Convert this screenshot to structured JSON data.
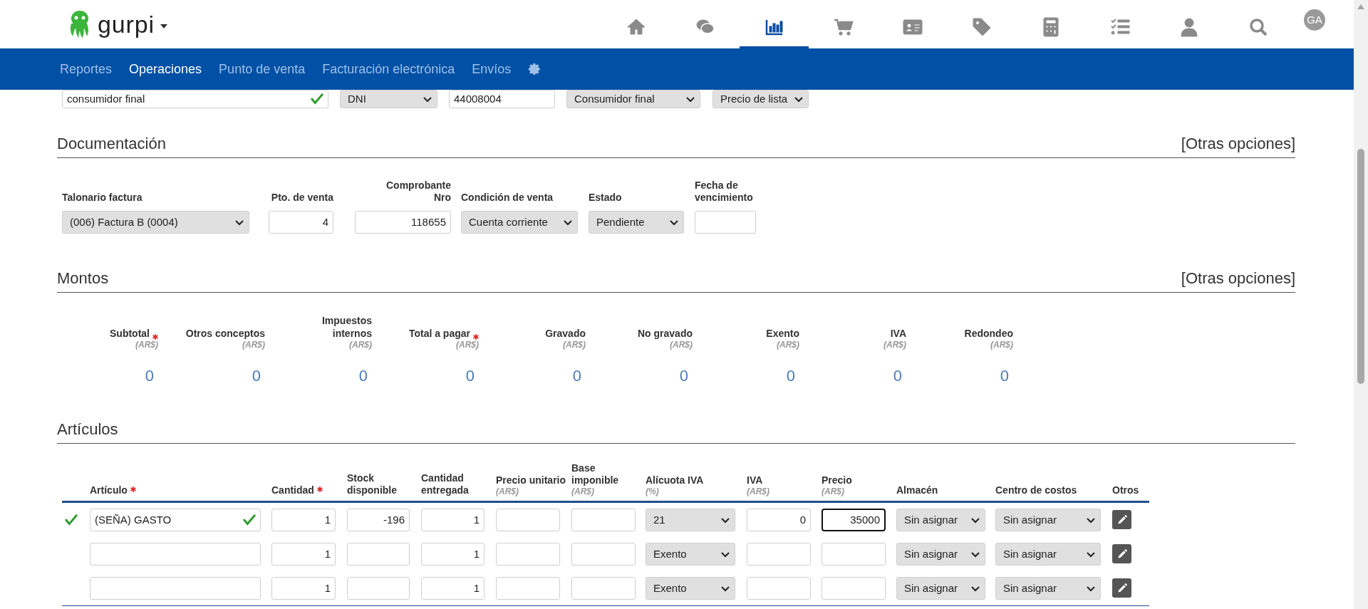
{
  "app": {
    "name": "gurpi"
  },
  "toolbar": [
    {
      "kind": "home",
      "selected": false
    },
    {
      "kind": "chat",
      "selected": false
    },
    {
      "kind": "chart",
      "selected": true
    },
    {
      "kind": "cart",
      "selected": false
    },
    {
      "kind": "card",
      "selected": false
    },
    {
      "kind": "tag",
      "selected": false
    },
    {
      "kind": "calculator",
      "selected": false
    },
    {
      "kind": "checklist",
      "selected": false
    },
    {
      "kind": "user",
      "selected": false
    },
    {
      "kind": "search",
      "selected": false
    }
  ],
  "avatar": "GA",
  "nav": [
    {
      "label": "Reportes",
      "selected": false
    },
    {
      "label": "Operaciones",
      "selected": true
    },
    {
      "label": "Punto de venta",
      "selected": false
    },
    {
      "label": "Facturación electrónica",
      "selected": false
    },
    {
      "label": "Envíos",
      "selected": false
    }
  ],
  "customer_row": [
    {
      "kind": "input",
      "value": "consumidor final",
      "valid": true
    },
    {
      "kind": "select",
      "value": "DNI"
    },
    {
      "kind": "input",
      "value": "44008004",
      "valid": false
    },
    {
      "kind": "select",
      "value": "Consumidor final"
    },
    {
      "kind": "select",
      "value": "Precio de lista"
    }
  ],
  "documentacion": {
    "title": "Documentación",
    "link": "[Otras opciones]",
    "fields": [
      {
        "label": "Talonario factura",
        "kind": "select",
        "value": "(006) Factura B (0004)"
      },
      {
        "label": "Pto. de venta",
        "kind": "number",
        "value": "4"
      },
      {
        "label": "Comprobante Nro",
        "kind": "number",
        "value": "118655"
      },
      {
        "label": "Condición de venta",
        "kind": "select",
        "value": "Cuenta corriente"
      },
      {
        "label": "Estado",
        "kind": "select",
        "value": "Pendiente"
      },
      {
        "label": "Fecha de vencimiento",
        "kind": "input"
      }
    ]
  },
  "montos": {
    "title": "Montos",
    "link": "[Otras opciones]",
    "columns": [
      {
        "label": "Subtotal",
        "required": true,
        "unit": "(AR$)",
        "value": "0"
      },
      {
        "label": "Otros conceptos",
        "required": false,
        "unit": "(AR$)",
        "value": "0"
      },
      {
        "label": "Impuestos internos",
        "required": false,
        "unit": "(AR$)",
        "value": "0"
      },
      {
        "label": "Total a pagar",
        "required": true,
        "unit": "(AR$)",
        "value": "0"
      },
      {
        "label": "Gravado",
        "required": false,
        "unit": "(AR$)",
        "value": "0"
      },
      {
        "label": "No gravado",
        "required": false,
        "unit": "(AR$)",
        "value": "0"
      },
      {
        "label": "Exento",
        "required": false,
        "unit": "(AR$)",
        "value": "0"
      },
      {
        "label": "IVA",
        "required": false,
        "unit": "(AR$)",
        "value": "0"
      },
      {
        "label": "Redondeo",
        "required": false,
        "unit": "(AR$)",
        "value": "0"
      }
    ]
  },
  "articulos": {
    "title": "Artículos",
    "columns": [
      {
        "label": "Artículo",
        "required": true
      },
      {
        "label": "Cantidad",
        "required": true
      },
      {
        "label": "Stock disponible",
        "required": false
      },
      {
        "label": "Cantidad entregada",
        "required": false
      },
      {
        "label": "Precio unitario",
        "required": false,
        "unit": "(AR$)"
      },
      {
        "label": "Base imponible",
        "required": false,
        "unit": "(AR$)"
      },
      {
        "label": "Alícuota IVA",
        "required": false,
        "unit": "(%)"
      },
      {
        "label": "IVA",
        "required": false,
        "unit": "(AR$)"
      },
      {
        "label": "Precio",
        "required": false,
        "unit": "(AR$)"
      },
      {
        "label": "Almacén",
        "required": false
      },
      {
        "label": "Centro de costos",
        "required": false
      },
      {
        "label": "Otros",
        "required": false
      }
    ],
    "rows": [
      {
        "valid": true,
        "cells": [
          {
            "kind": "text",
            "value": "(SEÑA) GASTO",
            "focused": false
          },
          {
            "kind": "number",
            "value": "1",
            "focused": false
          },
          {
            "kind": "number",
            "value": "-196",
            "focused": false
          },
          {
            "kind": "number",
            "value": "1",
            "focused": false
          },
          {
            "kind": "number",
            "focused": false
          },
          {
            "kind": "number",
            "focused": false
          },
          {
            "kind": "select",
            "value": "21",
            "focused": false
          },
          {
            "kind": "number",
            "value": "0",
            "focused": false
          },
          {
            "kind": "number",
            "value": "35000",
            "focused": true
          },
          {
            "kind": "select",
            "value": "Sin asignar",
            "focused": false
          },
          {
            "kind": "select",
            "value": "Sin asignar",
            "focused": false
          },
          {
            "kind": "edit",
            "focused": false
          }
        ]
      },
      {
        "valid": false,
        "cells": [
          {
            "kind": "text",
            "focused": false
          },
          {
            "kind": "number",
            "value": "1",
            "focused": false
          },
          {
            "kind": "number",
            "focused": false
          },
          {
            "kind": "number",
            "value": "1",
            "focused": false
          },
          {
            "kind": "number",
            "focused": false
          },
          {
            "kind": "number",
            "focused": false
          },
          {
            "kind": "select",
            "value": "Exento",
            "focused": false
          },
          {
            "kind": "number",
            "focused": false
          },
          {
            "kind": "number",
            "focused": false
          },
          {
            "kind": "select",
            "value": "Sin asignar",
            "focused": false
          },
          {
            "kind": "select",
            "value": "Sin asignar",
            "focused": false
          },
          {
            "kind": "edit",
            "focused": false
          }
        ]
      },
      {
        "valid": false,
        "cells": [
          {
            "kind": "text",
            "focused": false
          },
          {
            "kind": "number",
            "value": "1",
            "focused": false
          },
          {
            "kind": "number",
            "focused": false
          },
          {
            "kind": "number",
            "value": "1",
            "focused": false
          },
          {
            "kind": "number",
            "focused": false
          },
          {
            "kind": "number",
            "focused": false
          },
          {
            "kind": "select",
            "value": "Exento",
            "focused": false
          },
          {
            "kind": "number",
            "focused": false
          },
          {
            "kind": "number",
            "focused": false
          },
          {
            "kind": "select",
            "value": "Sin asignar",
            "focused": false
          },
          {
            "kind": "select",
            "value": "Sin asignar",
            "focused": false
          },
          {
            "kind": "edit",
            "focused": false
          }
        ]
      }
    ]
  }
}
